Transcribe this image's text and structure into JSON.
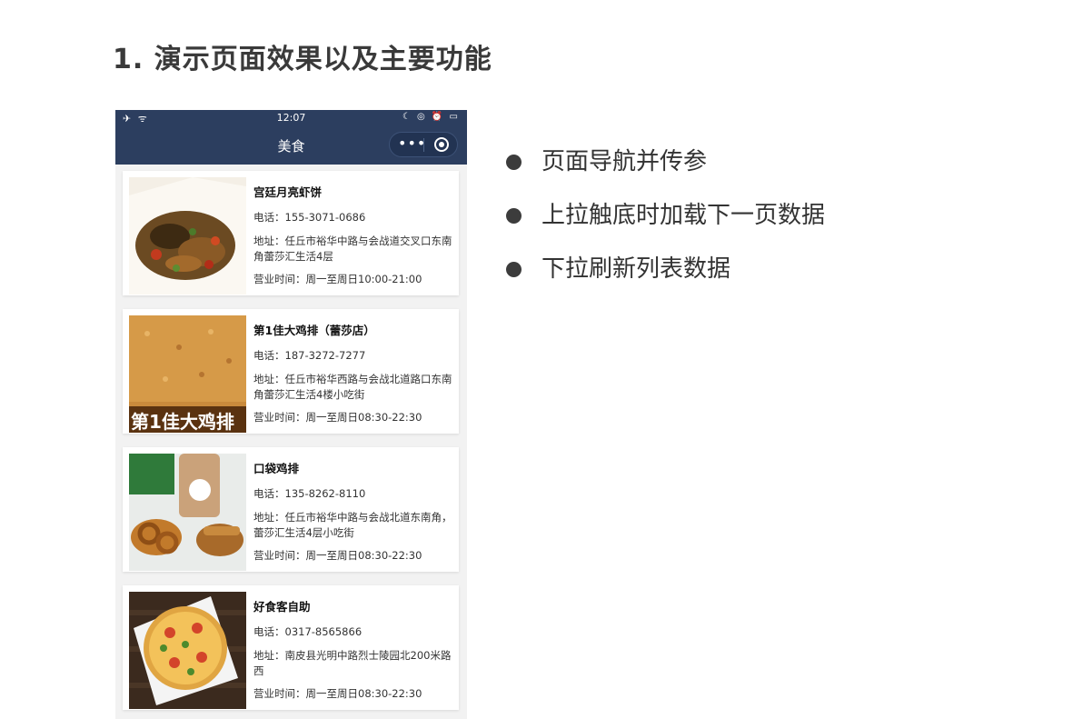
{
  "slide": {
    "title": "1. 演示页面效果以及主要功能",
    "bullets": [
      "页面导航并传参",
      "上拉触底时加载下一页数据",
      "下拉刷新列表数据"
    ]
  },
  "phone": {
    "status_bar": {
      "left_icons": "✈ ᯤ",
      "time": "12:07",
      "right_icons": "☾ ◎ ⏰ ▭"
    },
    "nav": {
      "title": "美食",
      "more_icon": "•••",
      "bg_color": "#2c3e5f"
    },
    "shops": [
      {
        "name": "宫廷月亮虾饼",
        "phone": "电话：155-3071-0686",
        "address": "地址：任丘市裕华中路与会战道交叉口东南角蕾莎汇生活4层",
        "hours": "营业时间：周一至周日10:00-21:00",
        "image": "fried-shrimp-cake-photo"
      },
      {
        "name": "第1佳大鸡排（蕾莎店）",
        "phone": "电话：187-3272-7277",
        "address": "地址：任丘市裕华西路与会战北道路口东南角蕾莎汇生活4楼小吃街",
        "hours": "营业时间：周一至周日08:30-22:30",
        "image": "chicken-cutlet-photo",
        "image_caption": "第1佳大鸡排"
      },
      {
        "name": "口袋鸡排",
        "phone": "电话：135-8262-8110",
        "address": "地址：任丘市裕华中路与会战北道东南角，蕾莎汇生活4层小吃街",
        "hours": "营业时间：周一至周日08:30-22:30",
        "image": "onion-rings-and-milk-tea-photo"
      },
      {
        "name": "好食客自助",
        "phone": "电话：0317-8565866",
        "address": "地址：南皮县光明中路烈士陵园北200米路西",
        "hours": "营业时间：周一至周日08:30-22:30",
        "image": "pizza-photo"
      }
    ]
  }
}
